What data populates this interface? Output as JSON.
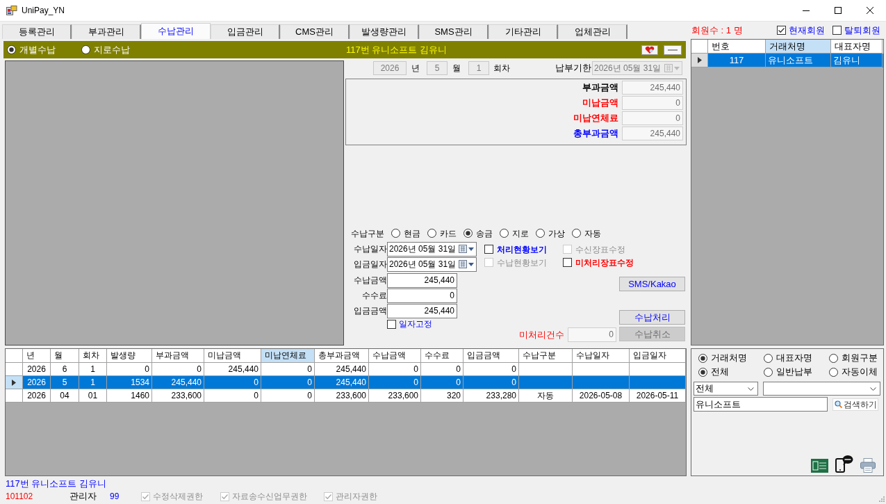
{
  "window": {
    "title": "UniPay_YN"
  },
  "tabs": [
    {
      "label": "등록관리",
      "selected": false
    },
    {
      "label": "부과관리",
      "selected": false
    },
    {
      "label": "수납관리",
      "selected": true
    },
    {
      "label": "입금관리",
      "selected": false
    },
    {
      "label": "CMS관리",
      "selected": false
    },
    {
      "label": "발생량관리",
      "selected": false
    },
    {
      "label": "SMS관리",
      "selected": false
    },
    {
      "label": "기타관리",
      "selected": false
    },
    {
      "label": "업체관리",
      "selected": false
    }
  ],
  "member_count": "회원수 : 1 명",
  "member_filters": [
    {
      "label": "현재회원",
      "checked": true
    },
    {
      "label": "탈퇴회원",
      "checked": false
    }
  ],
  "mode_bar": {
    "options": [
      {
        "label": "개별수납",
        "selected": true
      },
      {
        "label": "지로수납",
        "selected": false
      }
    ],
    "title": "117번 유니소프트 김유니"
  },
  "period": {
    "year": "2026",
    "year_unit": "년",
    "month": "5",
    "month_unit": "월",
    "round": "1",
    "round_unit": "회차",
    "due_label": "납부기한",
    "due_date": "2026년 05월 31일",
    "disabled": true
  },
  "summary": [
    {
      "label": "부과금액",
      "value": "245,440",
      "color": "#000000"
    },
    {
      "label": "미납금액",
      "value": "0",
      "color": "#ff0000"
    },
    {
      "label": "미납연체료",
      "value": "0",
      "color": "#ff0000"
    },
    {
      "label": "총부과금액",
      "value": "245,440",
      "color": "#0000ff"
    }
  ],
  "payment_form": {
    "type_label": "수납구분",
    "types": [
      {
        "label": "현금",
        "selected": false
      },
      {
        "label": "카드",
        "selected": false
      },
      {
        "label": "송금",
        "selected": true
      },
      {
        "label": "지로",
        "selected": false
      },
      {
        "label": "가상",
        "selected": false
      },
      {
        "label": "자동",
        "selected": false
      }
    ],
    "payment_date": {
      "label": "수납일자",
      "value": "2026년 05월 31일"
    },
    "deposit_date": {
      "label": "입금일자",
      "value": "2026년 05월 31일"
    },
    "amounts": [
      {
        "label": "수납금액",
        "value": "245,440"
      },
      {
        "label": "수수료",
        "value": "0"
      },
      {
        "label": "입금금액",
        "value": "245,440"
      }
    ],
    "fix_date": {
      "label": "일자고정",
      "checked": false
    },
    "options": [
      {
        "label": "처리현황보기",
        "checked": false,
        "disabled": false,
        "color": "#0000ff"
      },
      {
        "label": "수신장표수정",
        "checked": false,
        "disabled": true
      },
      {
        "label": "수납현황보기",
        "checked": false,
        "disabled": true
      },
      {
        "label": "미처리장표수정",
        "checked": false,
        "disabled": false,
        "color": "#ff0000"
      }
    ],
    "pending_count": {
      "label": "미처리건수",
      "value": "0"
    },
    "sms_button": {
      "label": "SMS/Kakao",
      "disabled": false
    },
    "process_button": {
      "label": "수납처리",
      "disabled": false
    },
    "cancel_button": {
      "label": "수납취소",
      "disabled": true
    }
  },
  "client_grid": {
    "columns": [
      {
        "label": "번호",
        "highlighted": false
      },
      {
        "label": "거래처명",
        "highlighted": true
      },
      {
        "label": "대표자명",
        "highlighted": false
      }
    ],
    "rows": [
      {
        "cells": [
          "117",
          "유니소프트",
          "김유니"
        ],
        "selected": true
      }
    ]
  },
  "history": {
    "columns": [
      {
        "label": "년",
        "highlighted": false
      },
      {
        "label": "월",
        "highlighted": false
      },
      {
        "label": "회차",
        "highlighted": false
      },
      {
        "label": "발생량",
        "highlighted": false
      },
      {
        "label": "부과금액",
        "highlighted": false
      },
      {
        "label": "미납금액",
        "highlighted": false
      },
      {
        "label": "미납연체료",
        "highlighted": true
      },
      {
        "label": "총부과금액",
        "highlighted": false
      },
      {
        "label": "수납금액",
        "highlighted": false
      },
      {
        "label": "수수료",
        "highlighted": false
      },
      {
        "label": "입금금액",
        "highlighted": false
      },
      {
        "label": "수납구분",
        "highlighted": false
      },
      {
        "label": "수납일자",
        "highlighted": false
      },
      {
        "label": "입금일자",
        "highlighted": false
      }
    ],
    "rows": [
      {
        "cells": [
          "2026",
          "6",
          "1",
          "0",
          "0",
          "245,440",
          "0",
          "245,440",
          "0",
          "0",
          "0",
          null,
          null,
          null
        ],
        "selected": false
      },
      {
        "cells": [
          "2026",
          "5",
          "1",
          "1534",
          "245,440",
          "0",
          "0",
          "245,440",
          "0",
          "0",
          "0",
          null,
          null,
          null
        ],
        "selected": true
      },
      {
        "cells": [
          "2026",
          "04",
          "01",
          "1460",
          "233,600",
          "0",
          "0",
          "233,600",
          "233,600",
          "320",
          "233,280",
          "자동",
          "2026-05-08",
          "2026-05-11"
        ],
        "selected": false
      }
    ]
  },
  "search_panel": {
    "search_by": [
      {
        "label": "거래처명",
        "selected": true
      },
      {
        "label": "대표자명",
        "selected": false
      },
      {
        "label": "회원구분",
        "selected": false
      }
    ],
    "payment_kind": [
      {
        "label": "전체",
        "selected": true
      },
      {
        "label": "일반납부",
        "selected": false
      },
      {
        "label": "자동이체",
        "selected": false
      }
    ],
    "category": "전체",
    "search_value": "유니소프트",
    "search_button": "검색하기"
  },
  "status": {
    "client": "117번 유니소프트 김유니",
    "user_code": "101102",
    "role": "관리자",
    "role_code": "99",
    "permissions": [
      {
        "label": "수정삭제권한",
        "checked": true,
        "disabled": true
      },
      {
        "label": "자료송수신업무권한",
        "checked": true,
        "disabled": true
      },
      {
        "label": "관리자권한",
        "checked": true,
        "disabled": true
      }
    ]
  }
}
